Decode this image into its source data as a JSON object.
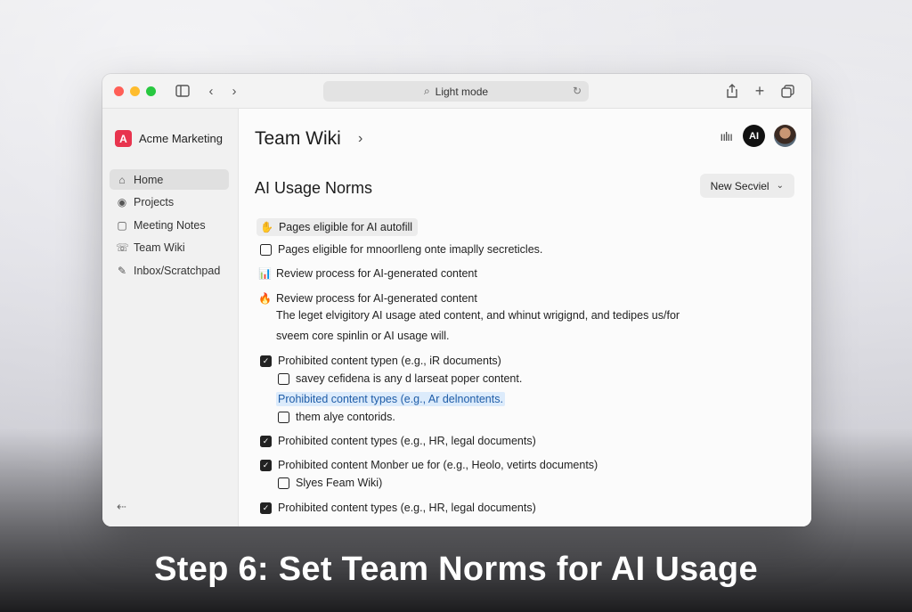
{
  "browser": {
    "address": "Light mode"
  },
  "workspace": {
    "logo_letter": "A",
    "name": "Acme Marketing"
  },
  "sidebar": {
    "items": [
      {
        "label": "Home",
        "icon": "home-icon"
      },
      {
        "label": "Projects",
        "icon": "projects-icon"
      },
      {
        "label": "Meeting Notes",
        "icon": "notes-icon"
      },
      {
        "label": "Team Wiki",
        "icon": "wiki-icon"
      },
      {
        "label": "Inbox/Scratchpad",
        "icon": "inbox-icon"
      }
    ]
  },
  "header": {
    "title": "Team Wiki",
    "ai_label": "AI"
  },
  "page": {
    "section_title": "AI Usage Norms",
    "new_button": "New Secviel"
  },
  "content": {
    "item1": "Pages eligible for AI autofill",
    "item2": "Pages eligible for mnoorlleng onte imaplly secreticles.",
    "item3": "Review process for AI-generated content",
    "item4": "Review process for AI-generated content",
    "para1": "The leget elvigitory AI usage ated content, and whinut wrigignd, and tedipes us/for",
    "para2": "sveem core spinlin or AI usage will.",
    "item5": "Prohibited content typen (e.g., iR documents)",
    "sub1": "savey cefidena is any d larseat poper content.",
    "sub_link": "Prohibited content types (e.g., Ar delnontents.",
    "sub2": "them alye contorids.",
    "item6": "Prohibited content types (e.g., HR, legal documents)",
    "item7": "Prohibited content Monber ue for (e.g., Heolo, vetirts documents)",
    "sub3": "Slyes Feam Wiki)",
    "item8": "Prohibited content types (e.g., HR, legal documents)"
  },
  "caption": "Step 6: Set Team Norms for AI Usage"
}
